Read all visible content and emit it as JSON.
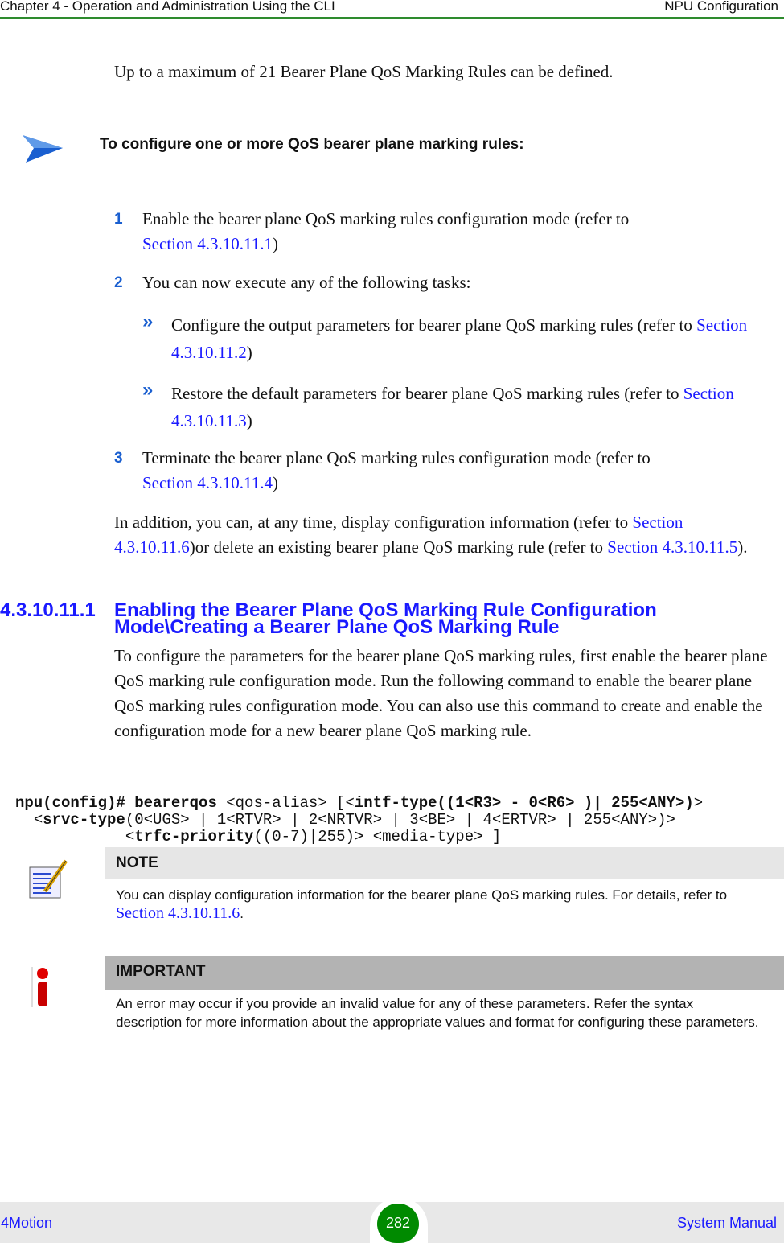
{
  "header": {
    "chapter": "Chapter 4 - Operation and Administration Using the CLI",
    "section": "NPU Configuration"
  },
  "intro": "Up to a maximum of 21 Bearer Plane QoS Marking Rules can be defined.",
  "procedure_title": "To configure one or more QoS bearer plane marking rules:",
  "steps": [
    {
      "num": "1",
      "text": "Enable the bearer plane QoS marking rules configuration mode (refer to",
      "link": "Section 4.3.10.11.1",
      "after": ")"
    },
    {
      "num": "2",
      "text": "You can now execute any of the following tasks:"
    },
    {
      "num": "3",
      "text": "Terminate the bearer plane QoS marking rules configuration mode (refer to",
      "link": "Section 4.3.10.11.4",
      "after": ")"
    }
  ],
  "bullets": [
    {
      "text": "Configure the output parameters for bearer plane QoS marking rules (refer to",
      "link": "Section 4.3.10.11.2",
      "after": ")"
    },
    {
      "text": "Restore the default parameters for bearer plane QoS marking rules (refer to",
      "link": "Section 4.3.10.11.3",
      "after": ")"
    }
  ],
  "addition": {
    "t1": "In addition, you can, at any time, display configuration information (refer to",
    "l1": "Section 4.3.10.11.6",
    "t2": ")or delete an existing bearer plane QoS marking rule (refer to",
    "l2": "Section 4.3.10.11.5",
    "t3": ")."
  },
  "section": {
    "number": "4.3.10.11.1",
    "title1": "Enabling the Bearer Plane QoS Marking Rule Configuration",
    "title2": "Mode\\Creating a Bearer Plane QoS Marking Rule",
    "body": "To configure the parameters for the bearer plane QoS marking rules, first enable the bearer plane QoS marking rule configuration mode. Run the following command to enable the bearer plane QoS marking rules configuration mode. You can also use this command to create and enable the configuration mode for a new bearer plane QoS marking rule."
  },
  "command": {
    "l1a": "npu(config)# bearerqos ",
    "l1b": "<qos-alias> [<",
    "l1c": "intf-type((1<R3> - 0<R6> )| 255<ANY>)",
    ">": ">",
    "l2a": "<",
    "l2b": "srvc-type",
    "l2c": "(0<UGS> | 1<RTVR> | 2<NRTVR> | 3<BE> | 4<ERTVR> | 255<ANY>)>",
    "l3a": "<",
    "l3b": "trfc-priority",
    "l3c": "((0-7)|255)> <media-type> ]"
  },
  "note": {
    "title": "NOTE",
    "text": "You can display configuration information for the bearer plane QoS marking rules. For details, refer to",
    "link": "Section 4.3.10.11.6",
    "after": "."
  },
  "important": {
    "title": "IMPORTANT",
    "text": "An error may occur if you provide an invalid value for any of these parameters. Refer the syntax description for more information about the appropriate values and format for configuring these parameters."
  },
  "footer": {
    "left": "4Motion",
    "page": "282",
    "right": "System Manual"
  },
  "colors": {
    "link": "#1a1aff",
    "header_rule": "#2e8b2e",
    "page_badge": "#008a00"
  }
}
